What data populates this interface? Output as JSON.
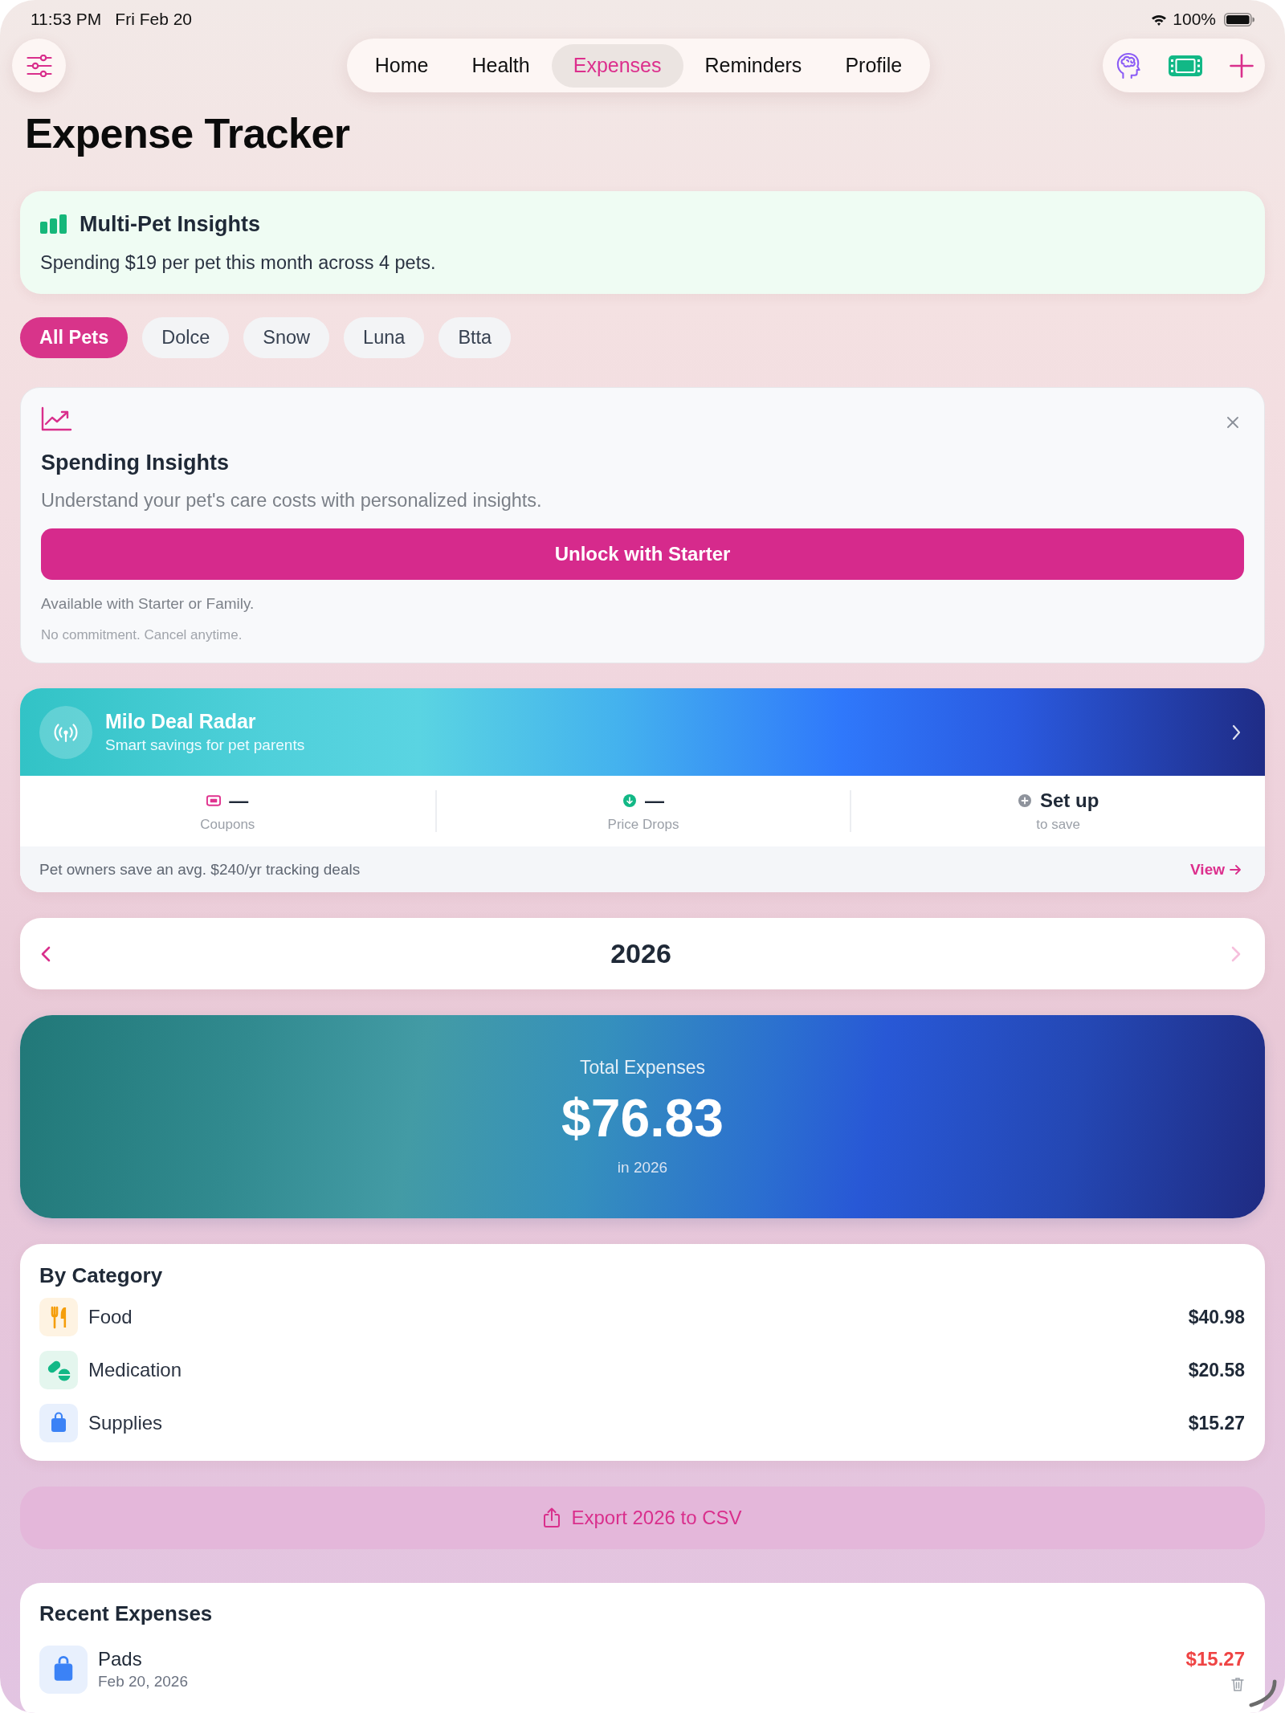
{
  "status_bar": {
    "time": "11:53 PM",
    "date": "Fri Feb 20",
    "battery": "100%"
  },
  "nav": {
    "tabs": [
      {
        "label": "Home",
        "selected": false
      },
      {
        "label": "Health",
        "selected": false
      },
      {
        "label": "Expenses",
        "selected": true
      },
      {
        "label": "Reminders",
        "selected": false
      },
      {
        "label": "Profile",
        "selected": false
      }
    ]
  },
  "page_title": "Expense Tracker",
  "multi_pet_insights": {
    "title": "Multi-Pet Insights",
    "text": "Spending $19 per pet this month across 4 pets."
  },
  "pet_filters": [
    {
      "label": "All Pets",
      "selected": true
    },
    {
      "label": "Dolce",
      "selected": false
    },
    {
      "label": "Snow",
      "selected": false
    },
    {
      "label": "Luna",
      "selected": false
    },
    {
      "label": "Btta",
      "selected": false
    }
  ],
  "spending_insights": {
    "title": "Spending Insights",
    "description": "Understand your pet's care costs with personalized insights.",
    "button": "Unlock with Starter",
    "availability": "Available with Starter or Family.",
    "note": "No commitment. Cancel anytime."
  },
  "deal_radar": {
    "title": "Milo Deal Radar",
    "subtitle": "Smart savings for pet parents",
    "stats": [
      {
        "kind": "coupons",
        "value": "—",
        "label": "Coupons"
      },
      {
        "kind": "price_drops",
        "value": "—",
        "label": "Price Drops"
      },
      {
        "kind": "setup",
        "value": "Set up",
        "label": "to save"
      }
    ],
    "footer": "Pet owners save an avg. $240/yr tracking deals",
    "link": "View"
  },
  "year_selector": {
    "year": "2026",
    "previous": {
      "disabled": false
    },
    "next": {
      "disabled": true
    }
  },
  "total": {
    "label": "Total Expenses",
    "amount": "$76.83",
    "period": "in 2026"
  },
  "by_category": {
    "title": "By Category",
    "items": [
      {
        "kind": "food",
        "label": "Food",
        "amount": "$40.98"
      },
      {
        "kind": "medication",
        "label": "Medication",
        "amount": "$20.58"
      },
      {
        "kind": "supplies",
        "label": "Supplies",
        "amount": "$15.27"
      }
    ]
  },
  "export_button": "Export 2026 to CSV",
  "recent_expenses": {
    "title": "Recent Expenses",
    "items": [
      {
        "kind": "supplies",
        "name": "Pads",
        "date": "Feb 20, 2026",
        "amount": "$15.27"
      }
    ]
  }
}
